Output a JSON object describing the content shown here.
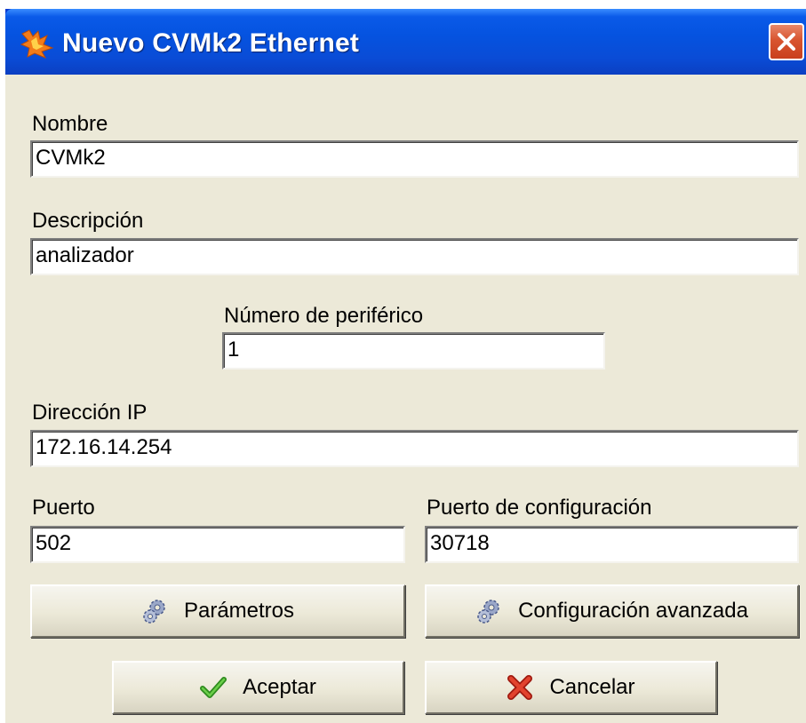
{
  "window": {
    "title": "Nuevo CVMk2 Ethernet",
    "app_icon": "flame-icon",
    "close_icon": "close-icon"
  },
  "form": {
    "nombre": {
      "label": "Nombre",
      "value": "CVMk2"
    },
    "descripcion": {
      "label": "Descripción",
      "value": "analizador"
    },
    "periferico": {
      "label": "Número de periférico",
      "value": "1"
    },
    "ip": {
      "label": "Dirección IP",
      "value": "172.16.14.254"
    },
    "puerto": {
      "label": "Puerto",
      "value": "502"
    },
    "puerto_config": {
      "label": "Puerto de configuración",
      "value": "30718"
    }
  },
  "buttons": {
    "parametros": {
      "label": "Parámetros",
      "icon": "gears-icon"
    },
    "config_avanzada": {
      "label": "Configuración avanzada",
      "icon": "gears-icon"
    },
    "aceptar": {
      "label": "Aceptar",
      "icon": "checkmark-icon"
    },
    "cancelar": {
      "label": "Cancelar",
      "icon": "red-x-icon"
    }
  },
  "colors": {
    "titlebar": "#0553E0",
    "dialog_bg": "#ECE9D8",
    "close_button": "#D8542F"
  }
}
